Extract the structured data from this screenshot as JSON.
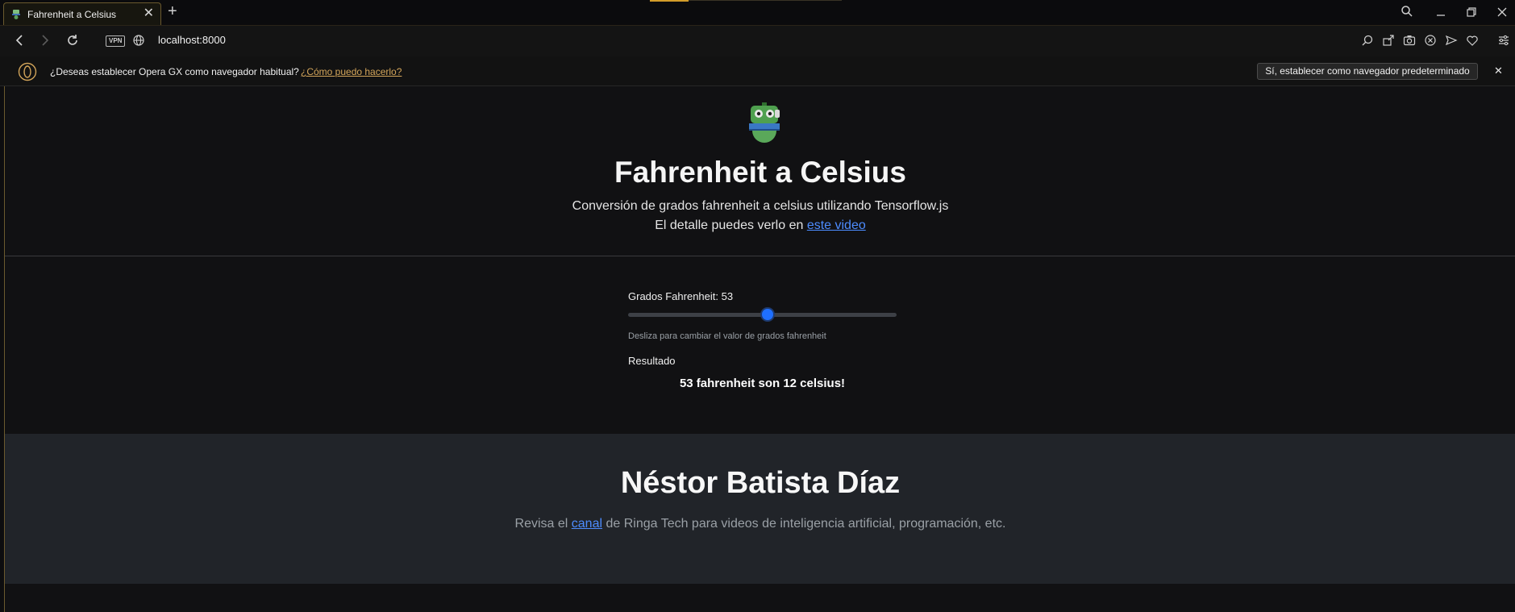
{
  "browser": {
    "tab": {
      "title": "Fahrenheit a Celsius",
      "close": "✕"
    },
    "new_tab": "+",
    "address": {
      "vpn_label": "VPN",
      "url": "localhost:8000"
    },
    "infobar": {
      "message": "¿Deseas establecer Opera GX como navegador habitual?",
      "link": "¿Cómo puedo hacerlo?",
      "button": "Sí, establecer como navegador predeterminado",
      "close": "✕"
    },
    "colors": {
      "accent": "#d39d2a",
      "link": "#4d8cff",
      "slider": "#1f6fff"
    }
  },
  "hero": {
    "title": "Fahrenheit a Celsius",
    "subtitle": "Conversión de grados fahrenheit a celsius utilizando Tensorflow.js",
    "detail_prefix": "El detalle puedes verlo en",
    "detail_link": "este video"
  },
  "converter": {
    "label": "Grados Fahrenheit: 53",
    "value": 53,
    "slider_fraction": 0.52,
    "help": "Desliza para cambiar el valor de grados fahrenheit",
    "result_label": "Resultado",
    "result": "53 fahrenheit son 12 celsius!"
  },
  "footer": {
    "title": "Néstor Batista Díaz",
    "text_before": "Revisa el",
    "link": "canal",
    "text_after": "de Ringa Tech para videos de inteligencia artificial, programación, etc."
  }
}
